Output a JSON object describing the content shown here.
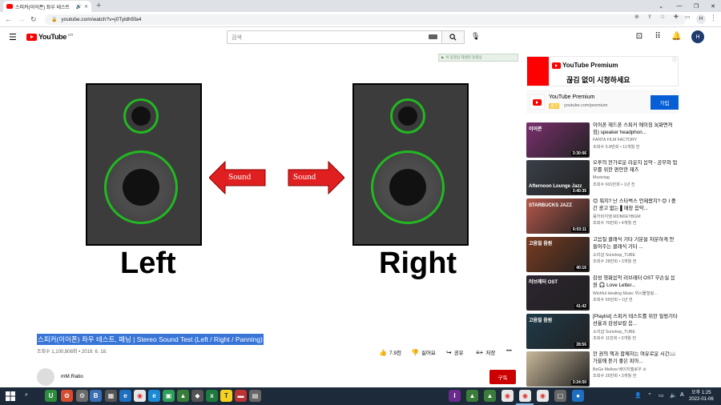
{
  "browser": {
    "tab_title": "스피커(이어폰) 좌우 테스트",
    "url": "youtube.com/watch?v=j0Tyldh5fa4"
  },
  "header": {
    "logo_text": "YouTube",
    "logo_region": "KR",
    "search_placeholder": "검색",
    "avatar_letter": "H"
  },
  "player": {
    "ad_label": "이 동영상 재생된 동영상",
    "left_label": "Left",
    "right_label": "Right",
    "arrow_left_text": "Sound",
    "arrow_right_text": "Sound"
  },
  "video": {
    "title": "스피커(이어폰) 좌우 테스트, 패닝 | Stereo Sound Test (Left / Right / Panning)",
    "meta": "조회수 1,100,808회 • 2019. 6. 18.",
    "like_count": "7.9천",
    "dislike_label": "싫어요",
    "share_label": "공유",
    "save_label": "저장",
    "more_label": "•••",
    "channel_name": "mM.Ratio",
    "subscribe_label": "구독"
  },
  "ad": {
    "logo_text": "YouTube Premium",
    "tagline": "끊김 없이 시청하세요",
    "name": "YouTube Premium",
    "badge": "광고",
    "url": "youtube.com/premium",
    "button": "가입",
    "info_icon": "info-icon"
  },
  "recommendations": [
    {
      "title": "이어폰 헤드폰 스피커 에이징 3(화면꺼짐) speaker headphon...",
      "channel": "FANTA FILM FACTORY",
      "views": "조회수 5.8만회 • 11개월 전",
      "duration": "3:30:06",
      "thumb_color": "#7a2f6e",
      "thumb_text": "이어폰"
    },
    {
      "title": "오후의 한가로운 라운지 음악 - 공부와 업무를 위한 편안한 재즈",
      "channel": "Musictag",
      "views": "조회수 601만회 • 1년 전",
      "duration": "3:40:35",
      "thumb_color": "#3a3f48",
      "thumb_text": "Afternoon Lounge Jazz"
    },
    {
      "title": "😊 뭐지? 난 스타벅스 언제왔지? 😊 I 중간 광고 없는 ▌매장 음악...",
      "channel": "몽키비지엠 MONKEYBGM",
      "views": "조회수 70만회 • 4개월 전",
      "duration": "6:03:11",
      "thumb_color": "#b4574a",
      "thumb_text": "STARBUCKS JAZZ"
    },
    {
      "title": "고음질 클래식 기타 기분을 차분하게 만들어주는 클래식 기타 ...",
      "channel": "소리샵 Sorishop_TUBE",
      "views": "조회수 28만회 • 3개월 전",
      "duration": "40:16",
      "thumb_color": "#7a3b1f",
      "thumb_text": "고음질 음원"
    },
    {
      "title": "감성 영화음악 러브레터 OST 무손실 음원 🎧 Love Letter...",
      "channel": "Wishful Healing Music 위시풀힐링...",
      "views": "조회수 55만회 • 1년 전",
      "duration": "41:42",
      "thumb_color": "#2c2430",
      "thumb_text": "러브레터 OST"
    },
    {
      "title": "[Playlist] 스피커 테스트를 위한 힐링기타 선율과 감성보컬 음...",
      "channel": "소리샵 Sorishop_TUBE",
      "views": "조회수 11만회 • 3개월 전",
      "duration": "28:56",
      "thumb_color": "#1e3a4a",
      "thumb_text": "고음질 음원"
    },
    {
      "title": "한 권의 책과 함께하는 여유로운 시간📖가을에 듣기 좋은 피아...",
      "channel": "BeGe Mellow 베이지멜로우 ⊘",
      "views": "조회수 25만회 • 3개월 전",
      "duration": "3:24:50",
      "thumb_color": "#c9b89a",
      "thumb_text": ""
    }
  ],
  "taskbar": {
    "time": "오후 1:25",
    "date": "2022-01-06"
  },
  "colors": {
    "accent_blue": "#065fd4",
    "youtube_red": "#ff0000",
    "speaker_ring": "#22b822",
    "arrow_red": "#e02020"
  }
}
